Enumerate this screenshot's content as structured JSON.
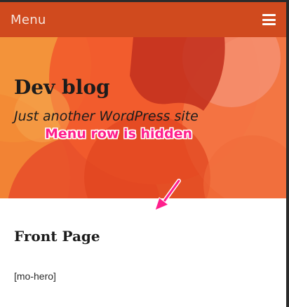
{
  "header": {
    "menu_label": "Menu",
    "menu_icon": "hamburger-icon"
  },
  "hero": {
    "site_title": "Dev blog",
    "tagline": "Just another WordPress site"
  },
  "annotation": {
    "text": "Menu row is hidden",
    "color": "#ff1f8c"
  },
  "content": {
    "page_title": "Front Page",
    "body_text": "[mo-hero]"
  },
  "colors": {
    "header_bg": "#d04a1e",
    "hero_base": "#f0612c"
  }
}
